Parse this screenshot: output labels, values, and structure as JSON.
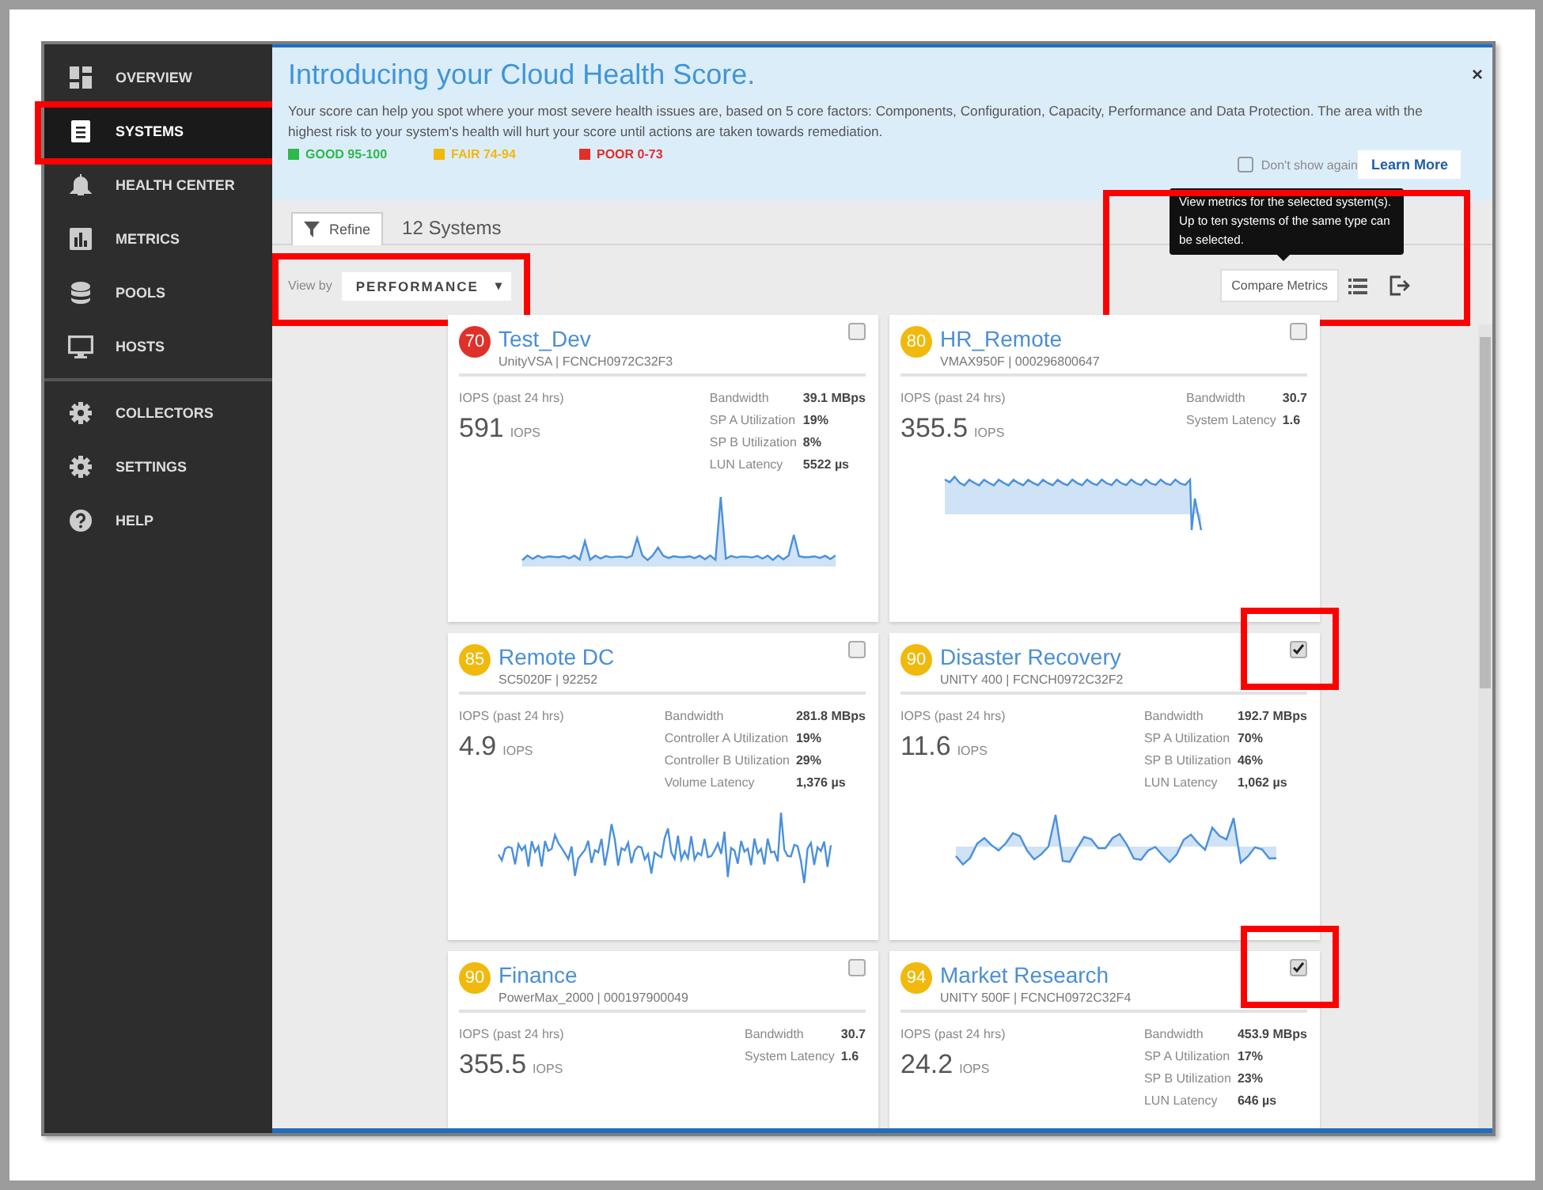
{
  "sidebar": {
    "sections": [
      {
        "items": [
          {
            "label": "OVERVIEW",
            "selected": false,
            "highlighted": false
          },
          {
            "label": "SYSTEMS",
            "selected": true,
            "highlighted": true
          },
          {
            "label": "HEALTH CENTER",
            "selected": false,
            "highlighted": false
          },
          {
            "label": "METRICS",
            "selected": false,
            "highlighted": false
          },
          {
            "label": "POOLS",
            "selected": false,
            "highlighted": false
          },
          {
            "label": "HOSTS",
            "selected": false,
            "highlighted": false
          }
        ]
      },
      {
        "items": [
          {
            "label": "COLLECTORS",
            "selected": false,
            "highlighted": false
          },
          {
            "label": "SETTINGS",
            "selected": false,
            "highlighted": false
          },
          {
            "label": "HELP",
            "selected": false,
            "highlighted": false
          }
        ]
      }
    ]
  },
  "banner": {
    "title": "Introducing your Cloud Health Score.",
    "text": "Your score can help you spot where your most severe health issues are, based on 5 core factors: Components, Configuration, Capacity, Performance and Data Protection. The area with the highest risk to your system's health will hurt your score until actions are taken towards remediation.",
    "legend": [
      {
        "label": "GOOD 95-100",
        "color": "#2fb84e"
      },
      {
        "label": "FAIR 74-94",
        "color": "#f0b90c"
      },
      {
        "label": "POOR 0-73",
        "color": "#e0302a"
      }
    ],
    "dont_show_again": {
      "label": "Don't show again",
      "checked": false
    },
    "learn_more": "Learn More",
    "close": "×"
  },
  "toolbar": {
    "refine": "Refine",
    "count": "12 Systems",
    "view_by": {
      "label": "View by",
      "value": "PERFORMANCE",
      "caret": "▾",
      "highlighted": true
    },
    "compare": {
      "button": "Compare Metrics",
      "tooltip": "View metrics for the selected system(s). Up to ten systems of the same type can be selected.",
      "highlighted": true
    }
  },
  "cards": [
    {
      "score": "70",
      "color": "#e0302a",
      "name": "Test_Dev",
      "subtitle": "UnityVSA | FCNCH0972C32F3",
      "iops_label": "IOPS (past 24 hrs)",
      "iops": "591",
      "iops_unit": "IOPS",
      "checked": false,
      "highlighted": false,
      "metrics": [
        {
          "label": "Bandwidth",
          "value": "39.1 MBps"
        },
        {
          "label": "SP A Utilization",
          "value": "19%"
        },
        {
          "label": "SP B Utilization",
          "value": "8%"
        },
        {
          "label": "LUN Latency",
          "value": "5522 µs"
        }
      ]
    },
    {
      "score": "80",
      "color": "#f0b90c",
      "name": "HR_Remote",
      "subtitle": "VMAX950F | 000296800647",
      "iops_label": "IOPS (past 24 hrs)",
      "iops": "355.5",
      "iops_unit": "IOPS",
      "checked": false,
      "highlighted": false,
      "metrics": [
        {
          "label": "Bandwidth",
          "value": "30.7"
        },
        {
          "label": "System Latency",
          "value": "1.6"
        }
      ]
    },
    {
      "score": "85",
      "color": "#f0b90c",
      "name": "Remote DC",
      "subtitle": "SC5020F | 92252",
      "iops_label": "IOPS (past 24 hrs)",
      "iops": "4.9",
      "iops_unit": "IOPS",
      "checked": false,
      "highlighted": false,
      "metrics": [
        {
          "label": "Bandwidth",
          "value": "281.8 MBps"
        },
        {
          "label": "Controller A Utilization",
          "value": "19%"
        },
        {
          "label": "Controller B Utilization",
          "value": "29%"
        },
        {
          "label": "Volume Latency",
          "value": "1,376 µs"
        }
      ]
    },
    {
      "score": "90",
      "color": "#f0b90c",
      "name": "Disaster Recovery",
      "subtitle": "UNITY 400 | FCNCH0972C32F2",
      "iops_label": "IOPS (past 24 hrs)",
      "iops": "11.6",
      "iops_unit": "IOPS",
      "checked": true,
      "highlighted": true,
      "metrics": [
        {
          "label": "Bandwidth",
          "value": "192.7 MBps"
        },
        {
          "label": "SP A Utilization",
          "value": "70%"
        },
        {
          "label": "SP B Utilization",
          "value": "46%"
        },
        {
          "label": "LUN Latency",
          "value": "1,062 µs"
        }
      ]
    },
    {
      "score": "90",
      "color": "#f0b90c",
      "name": "Finance",
      "subtitle": "PowerMax_2000 | 000197900049",
      "iops_label": "IOPS (past 24 hrs)",
      "iops": "355.5",
      "iops_unit": "IOPS",
      "checked": false,
      "highlighted": false,
      "metrics": [
        {
          "label": "Bandwidth",
          "value": "30.7"
        },
        {
          "label": "System Latency",
          "value": "1.6"
        }
      ]
    },
    {
      "score": "94",
      "color": "#f0b90c",
      "name": "Market Research",
      "subtitle": "UNITY 500F | FCNCH0972C32F4",
      "iops_label": "IOPS (past 24 hrs)",
      "iops": "24.2",
      "iops_unit": "IOPS",
      "checked": true,
      "highlighted": true,
      "metrics": [
        {
          "label": "Bandwidth",
          "value": "453.9 MBps"
        },
        {
          "label": "SP A Utilization",
          "value": "17%"
        },
        {
          "label": "SP B Utilization",
          "value": "23%"
        },
        {
          "label": "LUN Latency",
          "value": "646 µs"
        }
      ]
    }
  ]
}
